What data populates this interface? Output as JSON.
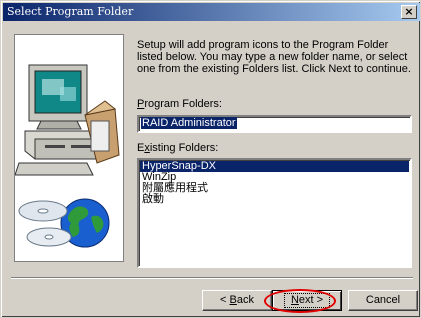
{
  "window": {
    "title": "Select Program Folder",
    "close_label": "×"
  },
  "description": "Setup will add program icons to the Program Folder listed below. You may type a new folder name, or select one from the existing Folders list.  Click Next to continue.",
  "program_folders": {
    "label_prefix": "P",
    "label_rest": "rogram Folders:",
    "value": "RAID Administrator"
  },
  "existing_folders": {
    "label_prefix": "x",
    "label_first": "E",
    "label_rest": "isting Folders:",
    "items": [
      {
        "label": "HyperSnap-DX",
        "selected": true
      },
      {
        "label": "WinZip",
        "selected": false
      },
      {
        "label": "附屬應用程式",
        "selected": false
      },
      {
        "label": "啟動",
        "selected": false
      }
    ]
  },
  "buttons": {
    "back_prefix": "< ",
    "back_ul": "B",
    "back_rest": "ack",
    "next_ul": "N",
    "next_rest": "ext >",
    "cancel": "Cancel"
  },
  "colors": {
    "title_start": "#0a246a",
    "title_end": "#a6caf0",
    "face": "#d4d0c8",
    "selection": "#0a246a",
    "highlight_ring": "#e00000"
  }
}
